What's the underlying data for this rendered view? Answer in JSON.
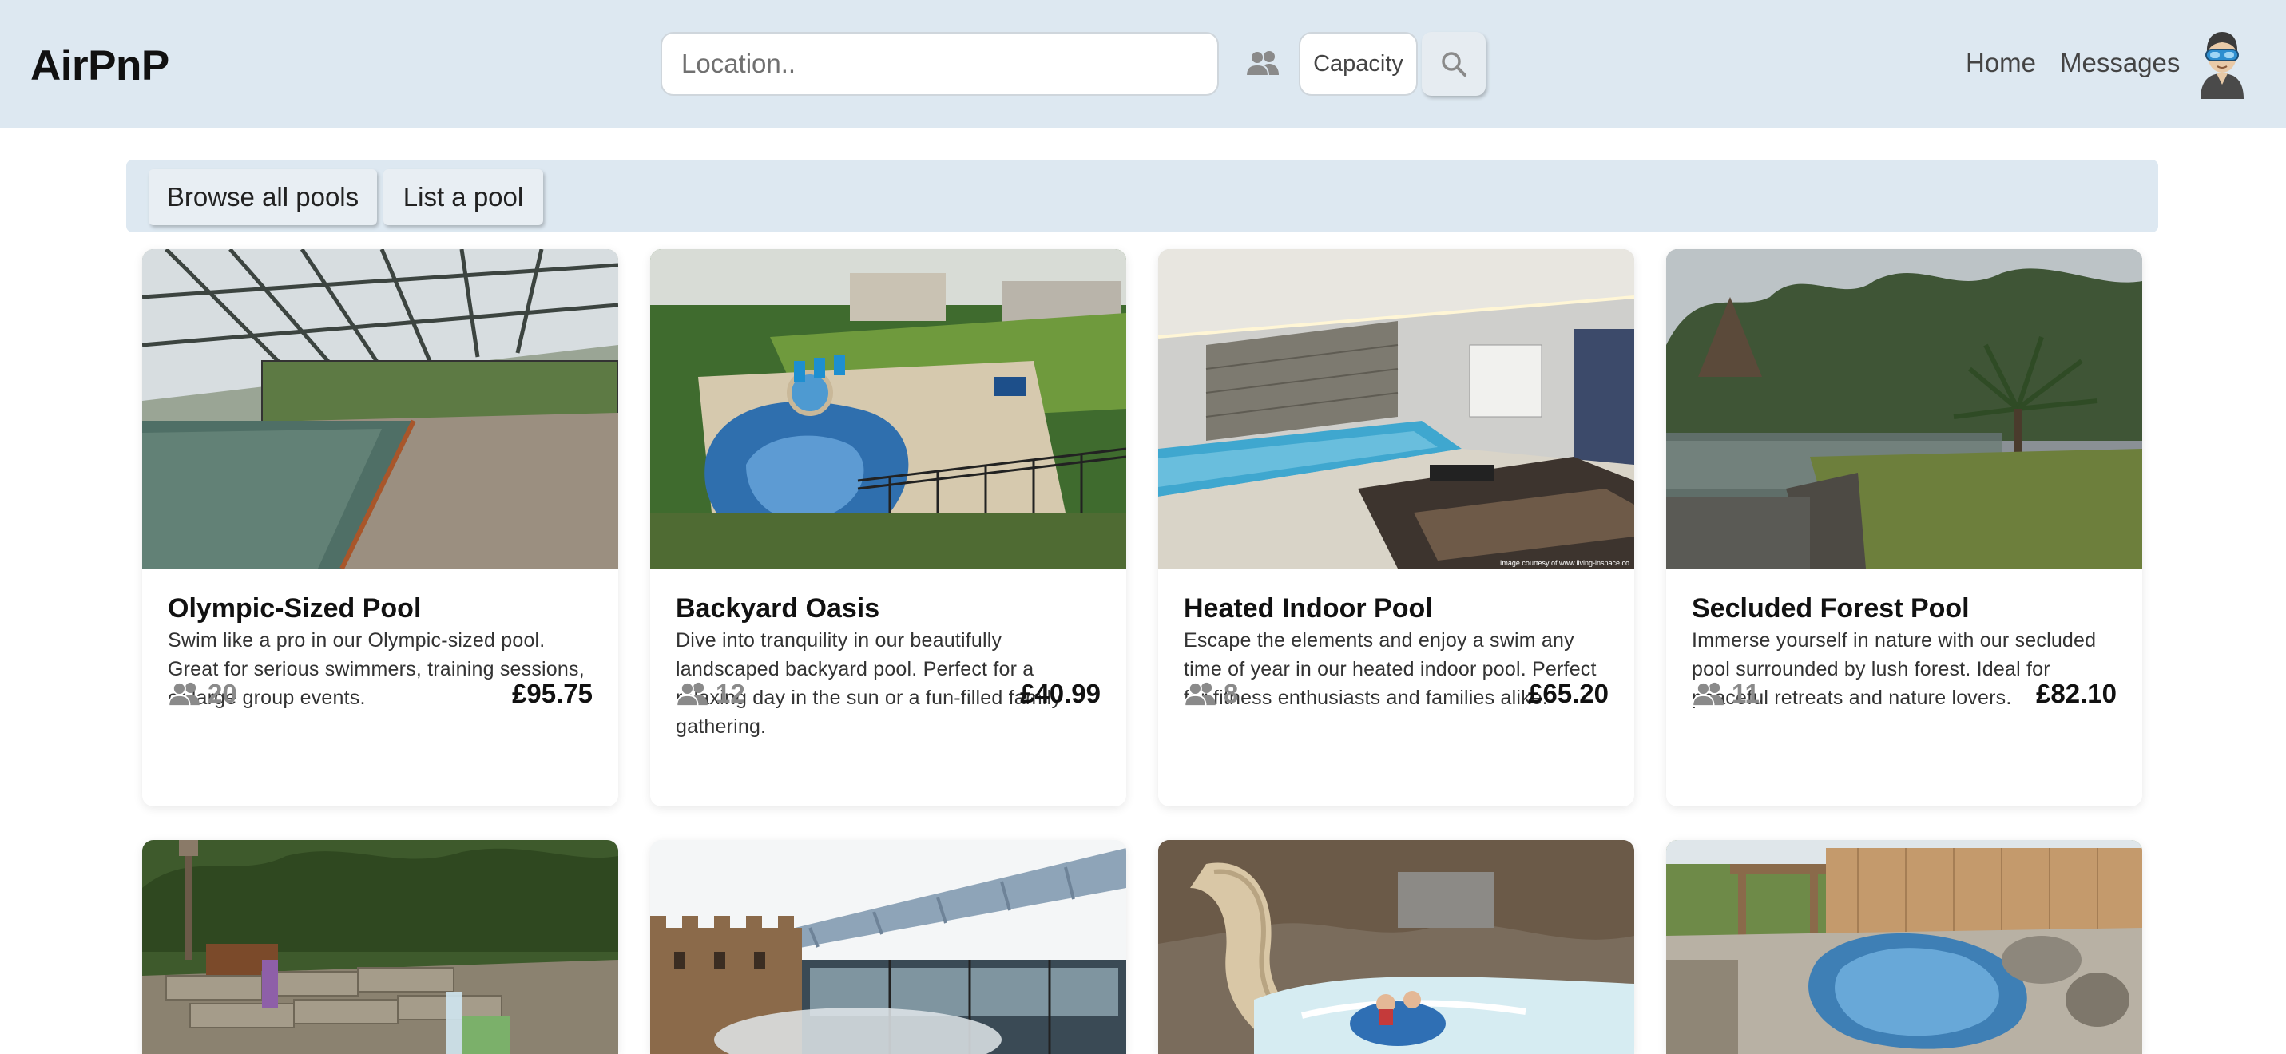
{
  "header": {
    "brand": "AirPnP",
    "search_placeholder": "Location..",
    "capacity_label": "Capacity",
    "nav": {
      "home": "Home",
      "messages": "Messages"
    }
  },
  "subnav": {
    "browse_label": "Browse all pools",
    "list_label": "List a pool"
  },
  "listings": [
    {
      "title": "Olympic-Sized Pool",
      "description": "Swim like a pro in our Olympic-sized pool. Great for serious swimmers, training sessions, or large group events.",
      "capacity": "20",
      "price": "£95.75",
      "image": "indoor-olympic-pool-photo"
    },
    {
      "title": "Backyard Oasis",
      "description": "Dive into tranquility in our beautifully landscaped backyard pool. Perfect for a relaxing day in the sun or a fun-filled family gathering.",
      "capacity": "12",
      "price": "£40.99",
      "image": "backyard-pool-photo"
    },
    {
      "title": "Heated Indoor Pool",
      "description": "Escape the elements and enjoy a swim any time of year in our heated indoor pool. Perfect for fitness enthusiasts and families alike.",
      "capacity": "8",
      "price": "£65.20",
      "image": "heated-indoor-pool-photo",
      "image_caption": "Image courtesy of www.living-inspace.co"
    },
    {
      "title": "Secluded Forest Pool",
      "description": "Immerse yourself in nature with our secluded pool surrounded by lush forest. Ideal for peaceful retreats and nature lovers.",
      "capacity": "11",
      "price": "£82.10",
      "image": "forest-pool-photo"
    }
  ],
  "second_row_images": [
    "waterfall-garden-pool-photo",
    "rooftop-castle-pool-photo",
    "waterslide-pool-photo",
    "freeform-backyard-pool-photo"
  ],
  "colors": {
    "header_bg": "#dde8f1",
    "icon_grey": "#8a8a8a"
  }
}
